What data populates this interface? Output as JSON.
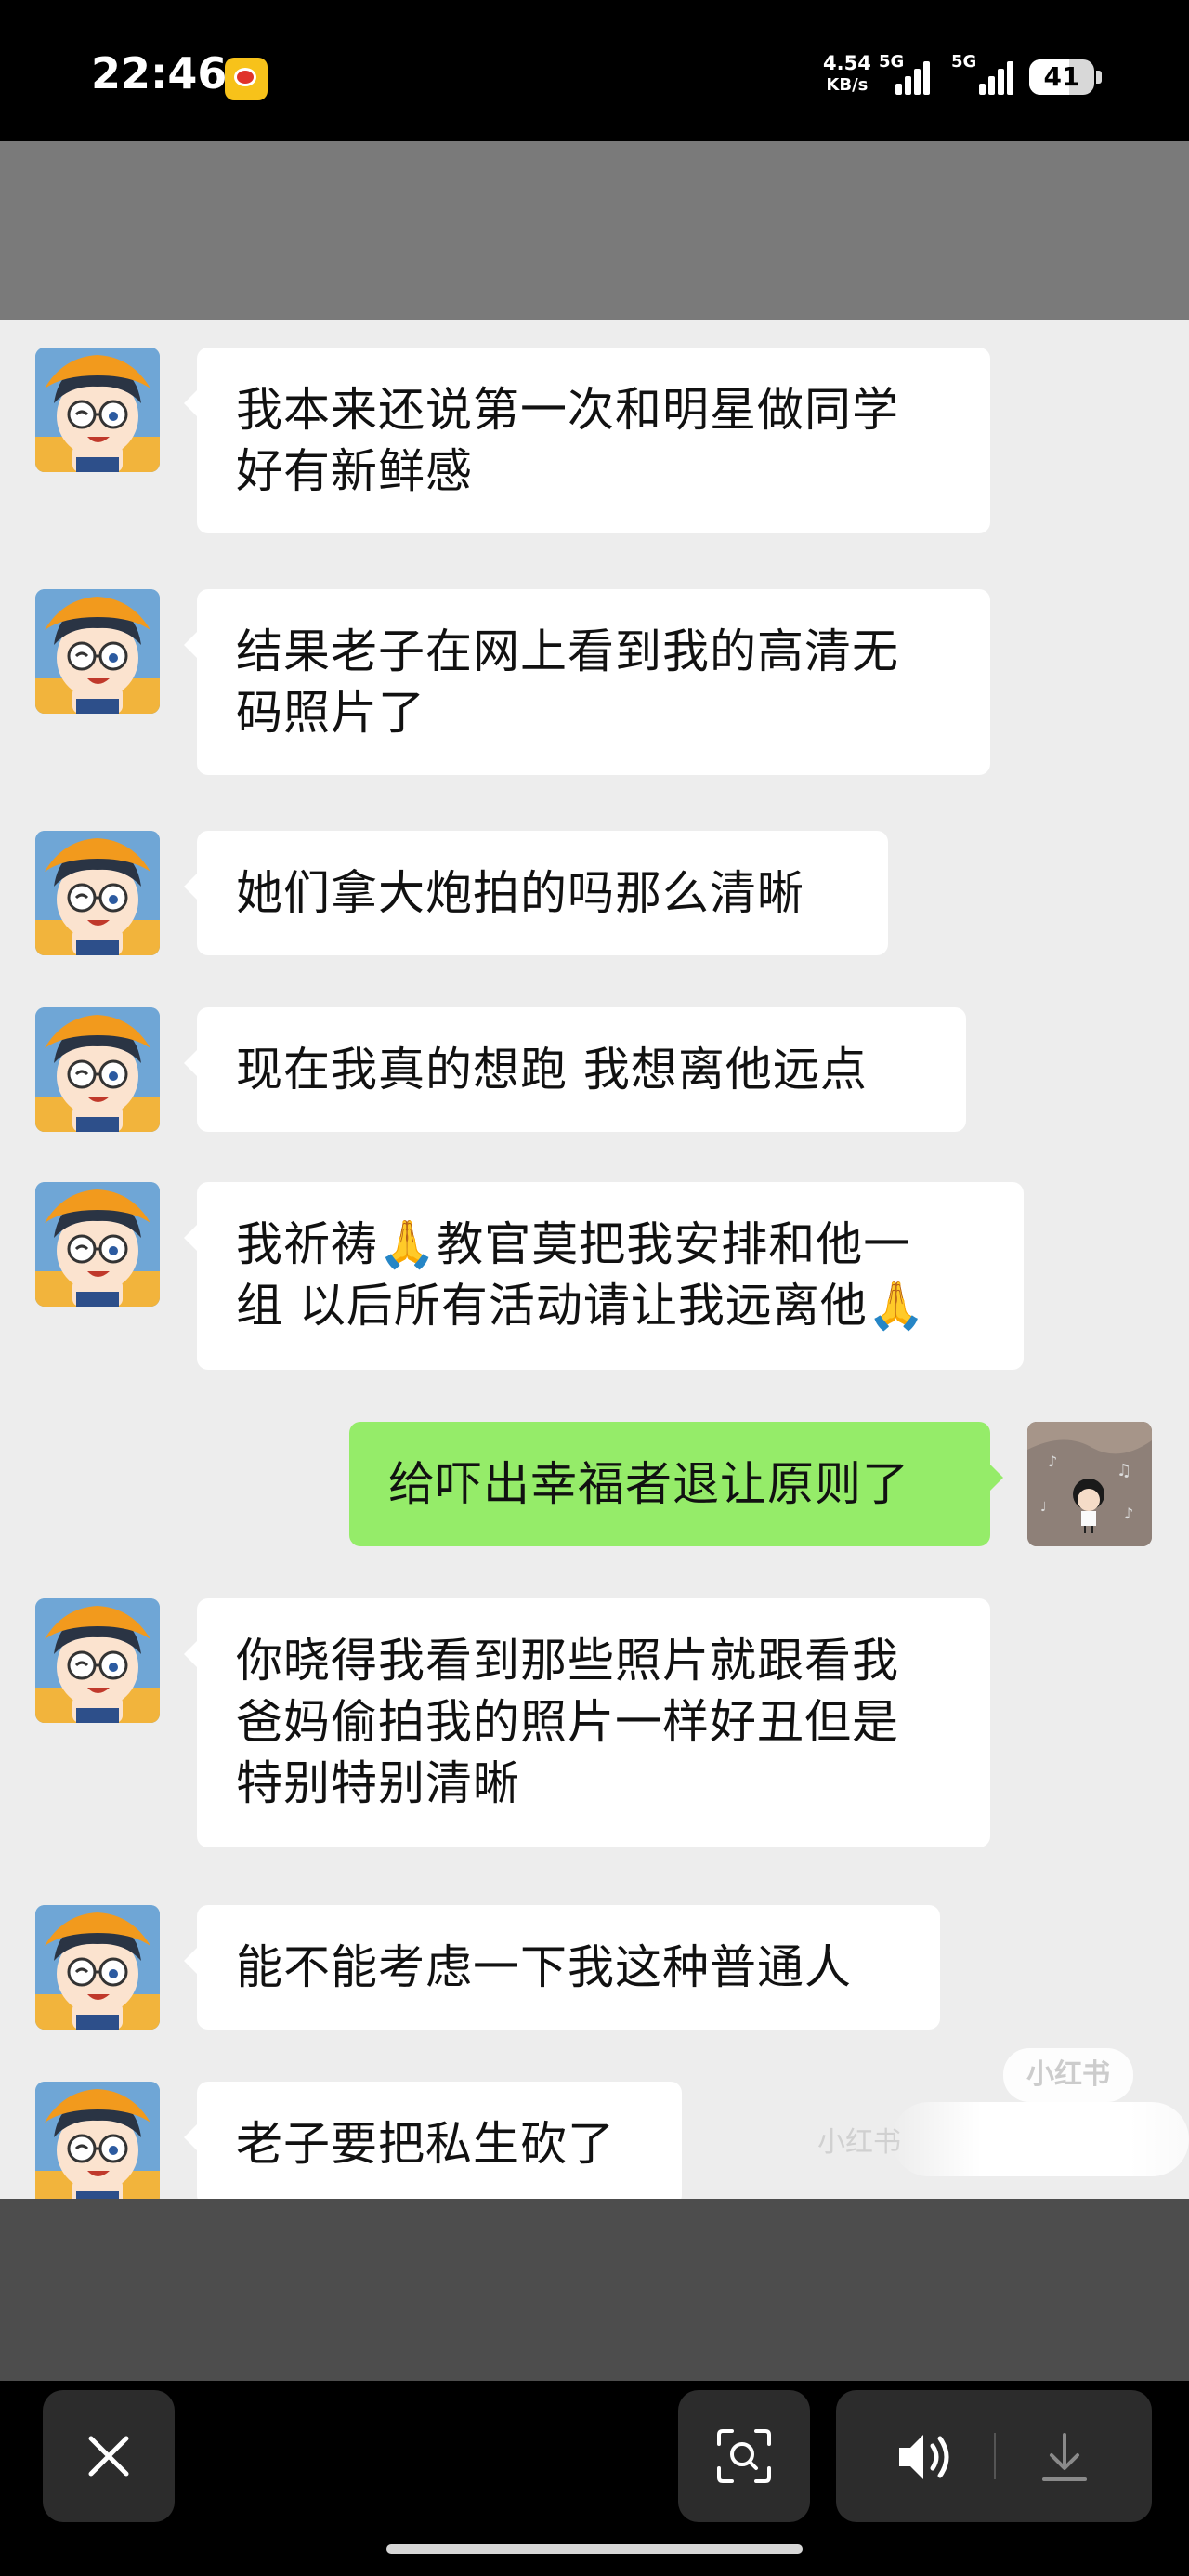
{
  "status_bar": {
    "time": "22:46",
    "net_speed_value": "4.54",
    "net_speed_unit": "KB/s",
    "signal1_label": "5G",
    "signal2_label": "5G",
    "battery": "41",
    "app_icon": "weibo-icon"
  },
  "messages": [
    {
      "side": "left",
      "lines": [
        "我本来还说第一次和明星做同学",
        "好有新鲜感"
      ]
    },
    {
      "side": "left",
      "lines": [
        "结果老子在网上看到我的高清无",
        "码照片了"
      ]
    },
    {
      "side": "left",
      "lines": [
        "她们拿大炮拍的吗那么清晰"
      ]
    },
    {
      "side": "left",
      "lines": [
        "现在我真的想跑 我想离他远点"
      ]
    },
    {
      "side": "left",
      "lines": [
        "我祈祷🙏教官莫把我安排和他一",
        "组 以后所有活动请让我远离他🙏"
      ]
    },
    {
      "side": "right",
      "lines": [
        "给吓出幸福者退让原则了"
      ]
    },
    {
      "side": "left",
      "lines": [
        "你晓得我看到那些照片就跟看我",
        "爸妈偷拍我的照片一样好丑但是",
        "特别特别清晰"
      ]
    },
    {
      "side": "left",
      "lines": [
        "能不能考虑一下我这种普通人"
      ]
    },
    {
      "side": "left",
      "lines": [
        "老子要把私生砍了"
      ]
    }
  ],
  "watermark": {
    "badge": "小红书",
    "text": "小红书"
  },
  "toolbar": {
    "close_icon": "close-icon",
    "scan_icon": "image-search-icon",
    "volume_icon": "speaker-icon",
    "download_icon": "download-icon"
  },
  "colors": {
    "chat_bg": "#ededed",
    "own_bubble": "#95ec69",
    "other_bubble": "#ffffff"
  }
}
